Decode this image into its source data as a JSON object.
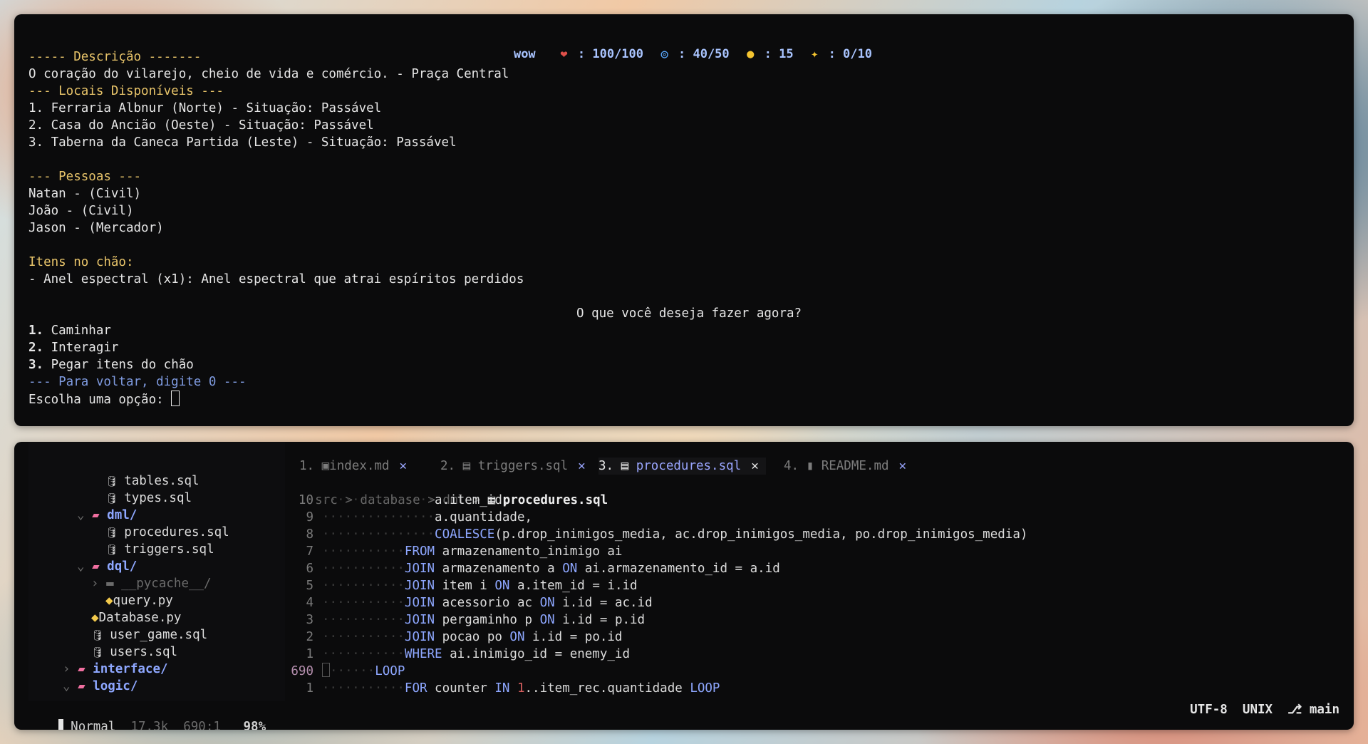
{
  "hud": {
    "title": "wow",
    "hp": "100/100",
    "mana": "40/50",
    "gold": "15",
    "xp": "0/10"
  },
  "game": {
    "desc_header": "----- Descrição -------",
    "desc": "O coração do vilarejo, cheio de vida e comércio. - Praça Central",
    "locais_header": "--- Locais Disponíveis ---",
    "locais": [
      "1. Ferraria Albnur (Norte) - Situação: Passável",
      "2. Casa do Ancião (Oeste) - Situação: Passável",
      "3. Taberna da Caneca Partida (Leste) - Situação: Passável"
    ],
    "pessoas_header": "--- Pessoas ---",
    "pessoas": [
      "Natan - (Civil)",
      "João - (Civil)",
      "Jason - (Mercador)"
    ],
    "itens_header": "Itens no chão:",
    "itens": [
      "- Anel espectral (x1): Anel espectral que atrai espíritos perdidos"
    ],
    "question": "O que você deseja fazer agora?",
    "options": [
      {
        "num": "1.",
        "label": " Caminhar"
      },
      {
        "num": "2.",
        "label": " Interagir"
      },
      {
        "num": "3.",
        "label": " Pegar itens do chão"
      }
    ],
    "back_hint": "--- Para voltar, digite 0 ---",
    "prompt": "Escolha uma opção: "
  },
  "tree": [
    {
      "indent": "    ",
      "name": "tables.sql"
    },
    {
      "indent": "    ",
      "name": "types.sql"
    },
    {
      "indent": "",
      "name": "dml/"
    },
    {
      "indent": "    ",
      "name": "procedures.sql"
    },
    {
      "indent": "    ",
      "name": "triggers.sql"
    },
    {
      "indent": "",
      "name": "dql/"
    },
    {
      "indent": "",
      "name": "__pycache__/"
    },
    {
      "indent": "",
      "name": "query.py"
    },
    {
      "indent": "",
      "name": "Database.py"
    },
    {
      "indent": "",
      "name": "user_game.sql"
    },
    {
      "indent": "",
      "name": "users.sql"
    },
    {
      "indent": "",
      "name": "interface/"
    },
    {
      "indent": "",
      "name": "logic/"
    }
  ],
  "tabs": [
    {
      "num": "1.",
      "label": "index.md",
      "close": "✕"
    },
    {
      "num": "2.",
      "label": "triggers.sql",
      "close": "✕"
    },
    {
      "num": "3.",
      "label": "procedures.sql",
      "close": "✕"
    },
    {
      "num": "4.",
      "label": "README.md",
      "close": "✕"
    }
  ],
  "breadcrumb": {
    "p1": "src",
    "p2": "database",
    "p3": "dml",
    "file": "procedures.sql",
    "sep": ">"
  },
  "code": [
    {
      "ln": "10",
      "text": "a.item_id,"
    },
    {
      "ln": "9",
      "text": "a.quantidade,"
    },
    {
      "ln": "8",
      "kw": "COALESCE",
      "text": "(p.drop_inimigos_media, ac.drop_inimigos_media, po.drop_inimigos_media)"
    },
    {
      "ln": "7",
      "kw": "FROM",
      "text": " armazenamento_inimigo ai"
    },
    {
      "ln": "6",
      "kw": "JOIN",
      "text": " armazenamento a ",
      "kw2": "ON",
      "text2": " ai.armazenamento_id = a.id"
    },
    {
      "ln": "5",
      "kw": "JOIN",
      "text": " item i ",
      "kw2": "ON",
      "text2": " a.item_id = i.id"
    },
    {
      "ln": "4",
      "kw": "JOIN",
      "text": " acessorio ac ",
      "kw2": "ON",
      "text2": " i.id = ac.id"
    },
    {
      "ln": "3",
      "kw": "JOIN",
      "text": " pergaminho p ",
      "kw2": "ON",
      "text2": " i.id = p.id"
    },
    {
      "ln": "2",
      "kw": "JOIN",
      "text": " pocao po ",
      "kw2": "ON",
      "text2": " i.id = po.id"
    },
    {
      "ln": "1",
      "kw": "WHERE",
      "text": " ai.inimigo_id = enemy_id"
    },
    {
      "ln": "690",
      "kw": "LOOP",
      "text": ""
    },
    {
      "ln": "1",
      "kw": "FOR",
      "text": " counter ",
      "kw2": "IN",
      "num": "1",
      "text2": "..item_rec.quantidade ",
      "kw3": "LOOP"
    }
  ],
  "status": {
    "mode": "Normal",
    "size": "17.3k",
    "pos": "690:1",
    "percent": "98%",
    "encoding": "UTF-8",
    "format": "UNIX",
    "branch": "main"
  }
}
